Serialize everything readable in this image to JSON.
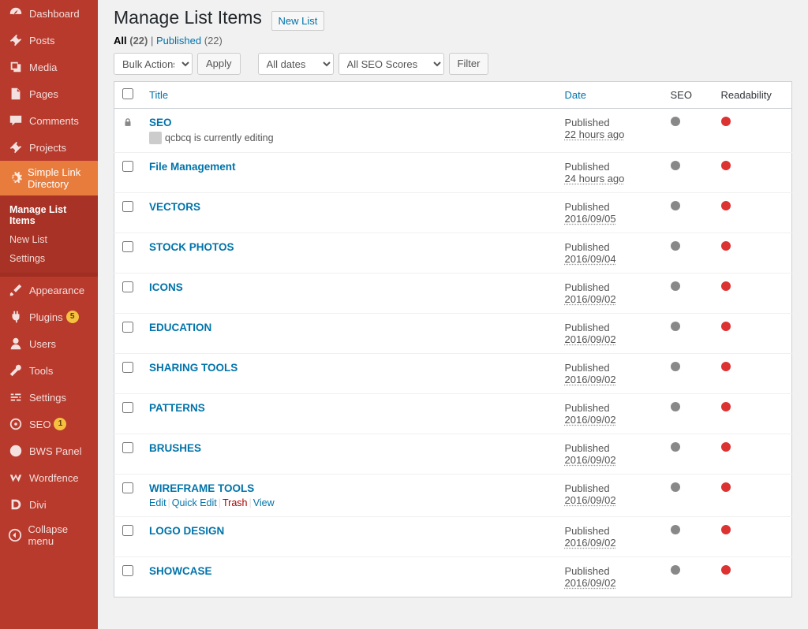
{
  "page": {
    "title": "Manage List Items",
    "action": "New List"
  },
  "views": {
    "all_label": "All",
    "all_count": "(22)",
    "published_label": "Published",
    "published_count": "(22)"
  },
  "nav": {
    "bulk": "Bulk Actions",
    "apply": "Apply",
    "dates": "All dates",
    "seo": "All SEO Scores",
    "filter": "Filter"
  },
  "columns": {
    "title": "Title",
    "date": "Date",
    "seo": "SEO",
    "readability": "Readability"
  },
  "menu": [
    {
      "label": "Dashboard",
      "icon": "dashboard"
    },
    {
      "label": "Posts",
      "icon": "pin"
    },
    {
      "label": "Media",
      "icon": "media"
    },
    {
      "label": "Pages",
      "icon": "page"
    },
    {
      "label": "Comments",
      "icon": "comment"
    },
    {
      "label": "Projects",
      "icon": "pin"
    },
    {
      "label": "Simple Link Directory",
      "icon": "gear",
      "current": true
    }
  ],
  "submenu": [
    {
      "label": "Manage List Items",
      "current": true
    },
    {
      "label": "New List"
    },
    {
      "label": "Settings"
    }
  ],
  "menu2": [
    {
      "label": "Appearance",
      "icon": "brush"
    },
    {
      "label": "Plugins",
      "icon": "plug",
      "badge": "5"
    },
    {
      "label": "Users",
      "icon": "user"
    },
    {
      "label": "Tools",
      "icon": "wrench"
    },
    {
      "label": "Settings",
      "icon": "sliders"
    },
    {
      "label": "SEO",
      "icon": "seo",
      "badge": "1"
    },
    {
      "label": "BWS Panel",
      "icon": "bws"
    },
    {
      "label": "Wordfence",
      "icon": "wf"
    },
    {
      "label": "Divi",
      "icon": "divi"
    },
    {
      "label": "Collapse menu",
      "icon": "collapse"
    }
  ],
  "lock_msg": "qcbcq is currently editing",
  "row_actions": {
    "edit": "Edit",
    "quick": "Quick Edit",
    "trash": "Trash",
    "view": "View"
  },
  "rows": [
    {
      "title": "SEO",
      "locked": true,
      "status": "Published",
      "when": "22 hours ago"
    },
    {
      "title": "File Management",
      "status": "Published",
      "when": "24 hours ago"
    },
    {
      "title": "VECTORS",
      "status": "Published",
      "when": "2016/09/05"
    },
    {
      "title": "STOCK PHOTOS",
      "status": "Published",
      "when": "2016/09/04"
    },
    {
      "title": "ICONS",
      "status": "Published",
      "when": "2016/09/02"
    },
    {
      "title": "EDUCATION",
      "status": "Published",
      "when": "2016/09/02"
    },
    {
      "title": "SHARING TOOLS",
      "status": "Published",
      "when": "2016/09/02"
    },
    {
      "title": "PATTERNS",
      "status": "Published",
      "when": "2016/09/02"
    },
    {
      "title": "BRUSHES",
      "status": "Published",
      "when": "2016/09/02"
    },
    {
      "title": "WIREFRAME TOOLS",
      "status": "Published",
      "when": "2016/09/02",
      "hover": true
    },
    {
      "title": "LOGO DESIGN",
      "status": "Published",
      "when": "2016/09/02"
    },
    {
      "title": "SHOWCASE",
      "status": "Published",
      "when": "2016/09/02"
    }
  ]
}
